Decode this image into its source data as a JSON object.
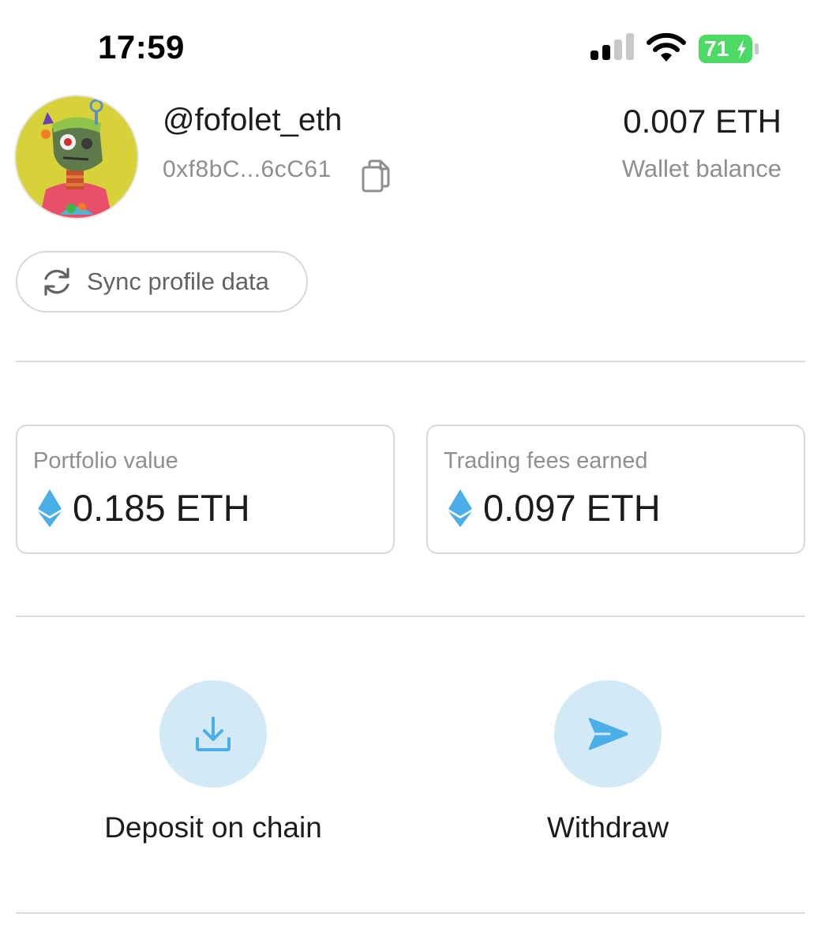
{
  "status_bar": {
    "time": "17:59",
    "battery_level": "71",
    "icons": [
      "cellular-signal-icon",
      "wifi-icon",
      "battery-charging-icon"
    ]
  },
  "profile": {
    "username": "@fofolet_eth",
    "address": "0xf8bC...6cC61",
    "copy_icon": "copy-icon",
    "wallet_balance_value": "0.007 ETH",
    "wallet_balance_label": "Wallet balance"
  },
  "sync": {
    "label": "Sync profile data",
    "icon": "refresh-icon"
  },
  "stats": [
    {
      "title": "Portfolio value",
      "value": "0.185 ETH",
      "icon": "ethereum-icon"
    },
    {
      "title": "Trading fees earned",
      "value": "0.097 ETH",
      "icon": "ethereum-icon"
    }
  ],
  "actions": [
    {
      "label": "Deposit on chain",
      "icon": "download-icon"
    },
    {
      "label": "Withdraw",
      "icon": "send-icon"
    }
  ],
  "colors": {
    "accent": "#4aaee8",
    "accent_bg": "#d3e9f6",
    "battery_green": "#4cd964",
    "muted_text": "#8e8e93",
    "border": "#d8d8dc"
  }
}
